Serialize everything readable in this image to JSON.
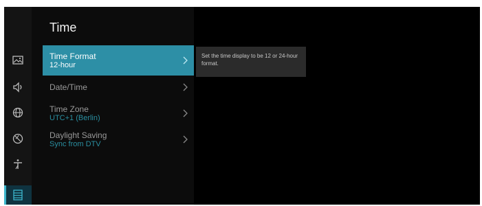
{
  "panel": {
    "title": "Time"
  },
  "rail": {
    "items": [
      {
        "icon": "picture-icon"
      },
      {
        "icon": "sound-icon"
      },
      {
        "icon": "globe-icon"
      },
      {
        "icon": "satellite-dish-icon"
      },
      {
        "icon": "antenna-icon"
      },
      {
        "icon": "settings-list-icon",
        "active": true
      }
    ]
  },
  "menu": {
    "items": [
      {
        "label": "Time Format",
        "value": "12-hour",
        "selected": true
      },
      {
        "label": "Date/Time",
        "value": ""
      },
      {
        "label": "Time Zone",
        "value": "UTC+1 (Berlin)"
      },
      {
        "label": "Daylight Saving",
        "value": "Sync from DTV"
      }
    ]
  },
  "tooltip": {
    "text": "Set the time display to be 12 or 24-hour format."
  },
  "colors": {
    "accent": "#2d8fa6",
    "value_text": "#2a8ea0",
    "background": "#000000"
  }
}
